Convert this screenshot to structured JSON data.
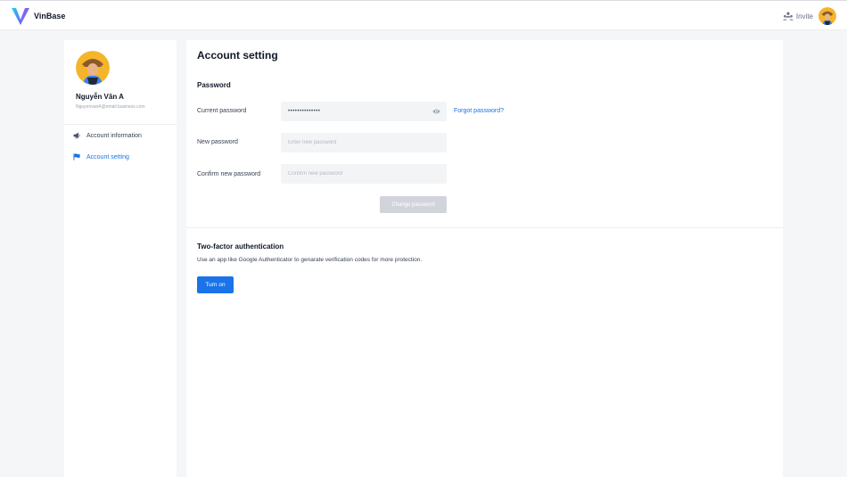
{
  "header": {
    "brand": "VinBase",
    "invite_label": "Invite"
  },
  "profile": {
    "name": "Nguyễn Văn A",
    "email": "NguyenvanA@email.business.com"
  },
  "sidebar": {
    "items": [
      {
        "label": "Account information",
        "icon": "megaphone-icon",
        "active": false
      },
      {
        "label": "Account setting",
        "icon": "flag-icon",
        "active": true
      }
    ]
  },
  "main": {
    "title": "Account setting",
    "password_section": {
      "title": "Password",
      "current_label": "Current password",
      "current_value": "••••••••••••••",
      "forgot_link": "Forgot password?",
      "new_label": "New password",
      "new_placeholder": "Enter new password",
      "confirm_label": "Confirm new password",
      "confirm_placeholder": "Confirm new password",
      "change_button": "Change password"
    },
    "two_factor": {
      "title": "Two-factor authentication",
      "description": "Use an app like Google Authenticator to genarate verification codes for more protection.",
      "button": "Turn on"
    }
  },
  "colors": {
    "accent": "#1a73e8",
    "disabled_button": "#d1d5db",
    "input_bg": "#f3f4f6",
    "page_bg": "#f5f6f8"
  }
}
